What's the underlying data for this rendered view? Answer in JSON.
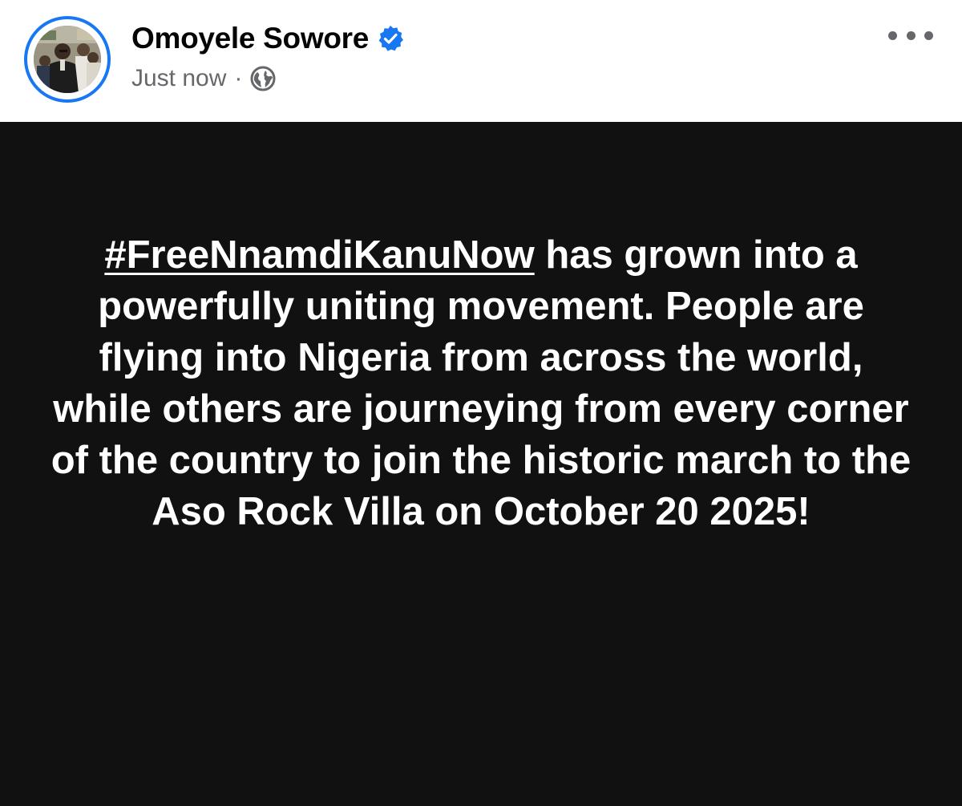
{
  "post": {
    "author": {
      "name": "Omoyele Sowore",
      "verified": true,
      "verified_icon": "verified-badge-icon",
      "avatar_icon": "profile-photo",
      "ring_color": "#1877f2"
    },
    "meta": {
      "timestamp": "Just now",
      "separator": "·",
      "audience_icon": "globe-icon"
    },
    "menu_icon": "more-options-icon",
    "background_color": "#111111",
    "text_color": "#ffffff",
    "hashtag": "#FreeNnamdiKanuNow",
    "body_text": " has grown into a powerfully uniting movement. People are flying into Nigeria from across the world, while others are journeying from every corner of the country to join the historic march to the Aso Rock Villa on October 20 2025!"
  }
}
